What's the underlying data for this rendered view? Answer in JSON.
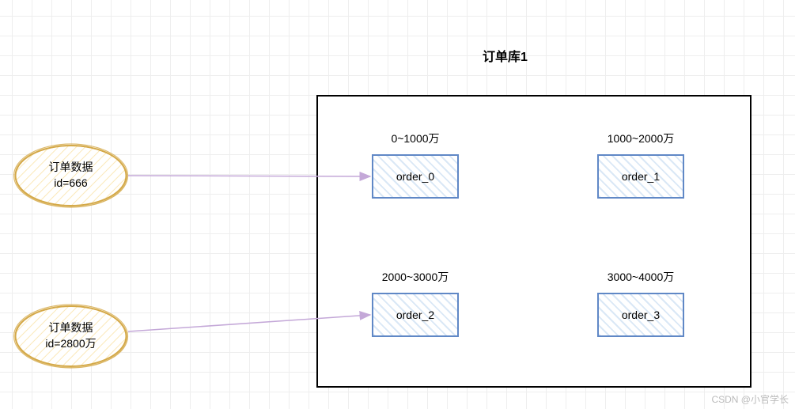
{
  "title": "订单库1",
  "data_nodes": [
    {
      "label": "订单数据",
      "sub": "id=666"
    },
    {
      "label": "订单数据",
      "sub": "id=2800万"
    }
  ],
  "tables": [
    {
      "range": "0~1000万",
      "name": "order_0"
    },
    {
      "range": "1000~2000万",
      "name": "order_1"
    },
    {
      "range": "2000~3000万",
      "name": "order_2"
    },
    {
      "range": "3000~4000万",
      "name": "order_3"
    }
  ],
  "watermark": "CSDN @小官学长"
}
